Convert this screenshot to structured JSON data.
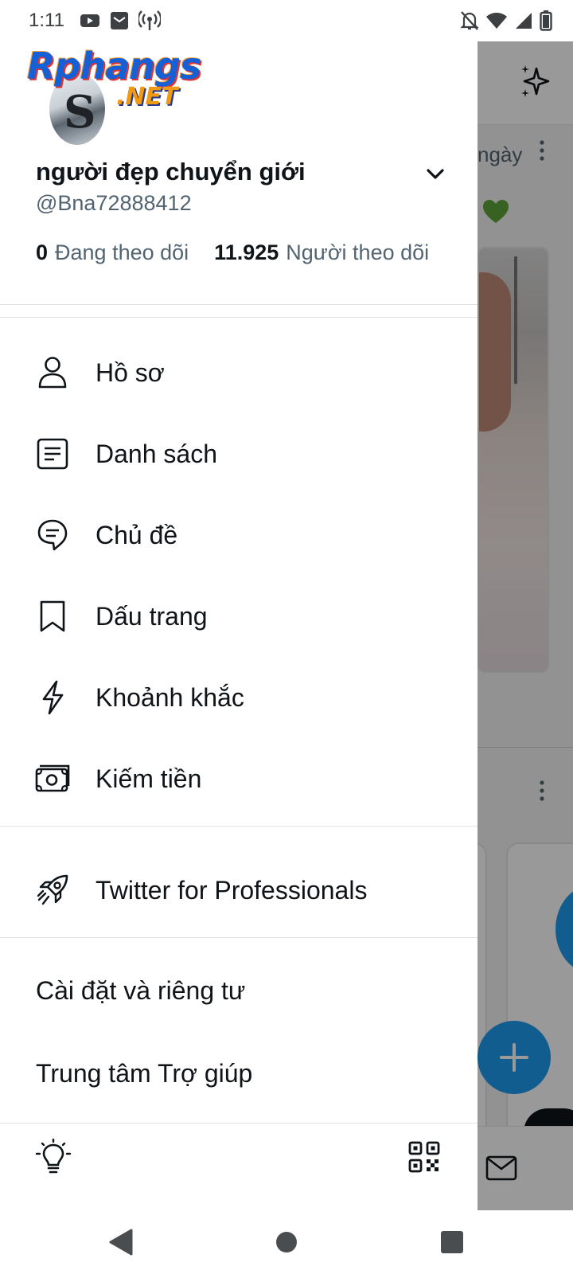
{
  "status_bar": {
    "time": "1:11",
    "left_icons": [
      "youtube-icon",
      "mail-notification-icon",
      "hotspot-icon"
    ],
    "right_icons": [
      "notifications-off-icon",
      "wifi-icon",
      "signal-icon",
      "battery-icon"
    ]
  },
  "drawer": {
    "logo_text": "Rphangs",
    "logo_suffix": ".NET",
    "profile": {
      "display_name": "người đẹp chuyển giới",
      "handle": "@Bna72888412",
      "following_count": "0",
      "following_label": "Đang theo dõi",
      "followers_count": "11.925",
      "followers_label": "Người theo dõi"
    },
    "menu": [
      {
        "label": "Hồ sơ",
        "icon": "profile-icon"
      },
      {
        "label": "Danh sách",
        "icon": "lists-icon"
      },
      {
        "label": "Chủ đề",
        "icon": "topics-icon"
      },
      {
        "label": "Dấu trang",
        "icon": "bookmark-icon"
      },
      {
        "label": "Khoảnh khắc",
        "icon": "moments-icon"
      },
      {
        "label": "Kiếm tiền",
        "icon": "monetization-icon"
      }
    ],
    "professional": {
      "label": "Twitter for Professionals",
      "icon": "rocket-icon"
    },
    "settings_label": "Cài đặt và riêng tư",
    "help_label": "Trung tâm Trợ giúp",
    "bottom_icons": [
      "lightbulb-icon",
      "qr-code-icon"
    ]
  },
  "background_timeline": {
    "time_snippet": "ngày"
  },
  "nav_bar": [
    "back-icon",
    "home-icon",
    "recents-icon"
  ]
}
